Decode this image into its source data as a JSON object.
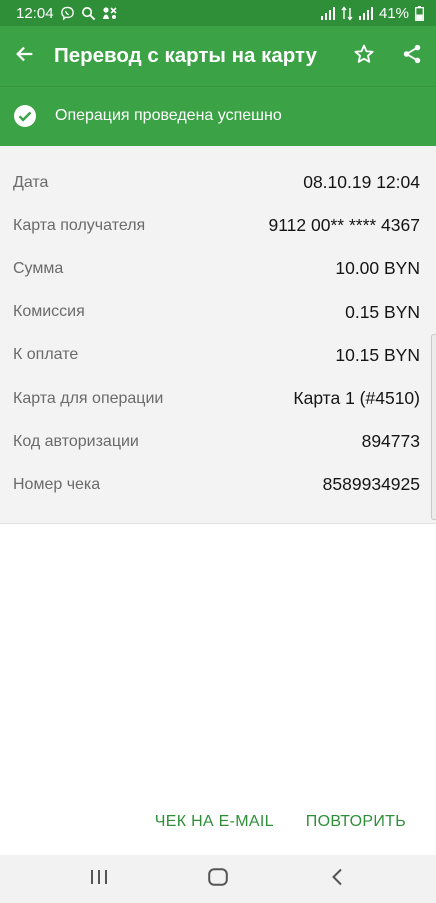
{
  "status_bar": {
    "time": "12:04",
    "battery": "41%"
  },
  "app_bar": {
    "title": "Перевод с карты на карту"
  },
  "banner": {
    "text": "Операция проведена успешно"
  },
  "details": [
    {
      "label": "Дата",
      "value": "08.10.19 12:04"
    },
    {
      "label": "Карта получателя",
      "value": "9112 00** **** 4367"
    },
    {
      "label": "Сумма",
      "value": "10.00 BYN"
    },
    {
      "label": "Комиссия",
      "value": "0.15 BYN"
    },
    {
      "label": "К оплате",
      "value": "10.15 BYN"
    },
    {
      "label": "Карта для операции",
      "value": "Карта 1 (#4510)"
    },
    {
      "label": "Код авторизации",
      "value": "894773"
    },
    {
      "label": "Номер чека",
      "value": "8589934925"
    }
  ],
  "actions": {
    "email_receipt": "ЧЕК НА E-MAIL",
    "repeat": "ПОВТОРИТЬ"
  },
  "colors": {
    "status_bar": "#2f8f39",
    "primary": "#3ba245",
    "accent_text": "#2f8f39"
  }
}
